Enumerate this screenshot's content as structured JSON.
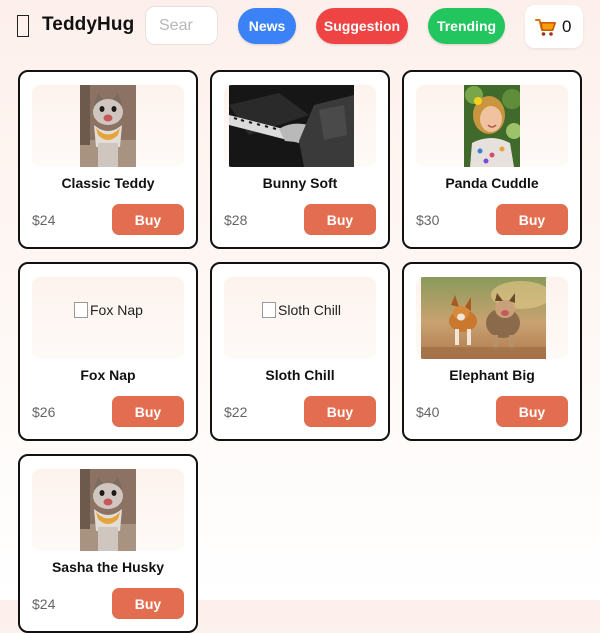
{
  "header": {
    "logo_icon": "bear-icon",
    "brand": "TeddyHug",
    "search_placeholder": "Sear",
    "nav": [
      {
        "label": "News",
        "color": "#3b82f6"
      },
      {
        "label": "Suggestion",
        "color": "#ef4444"
      },
      {
        "label": "Trending",
        "color": "#22c55e"
      }
    ],
    "cart_icon": "shopping-cart-icon",
    "cart_count": "0"
  },
  "buy_color": "#e26d50",
  "products": [
    {
      "name": "Classic Teddy",
      "price": "$24",
      "buy_label": "Buy",
      "image": "cat-photo"
    },
    {
      "name": "Bunny Soft",
      "price": "$28",
      "buy_label": "Buy",
      "image": "piano-photo"
    },
    {
      "name": "Panda Cuddle",
      "price": "$30",
      "buy_label": "Buy",
      "image": "girl-photo"
    },
    {
      "name": "Fox Nap",
      "price": "$26",
      "buy_label": "Buy",
      "image_alt": "Fox Nap"
    },
    {
      "name": "Sloth Chill",
      "price": "$22",
      "buy_label": "Buy",
      "image_alt": "Sloth Chill"
    },
    {
      "name": "Elephant Big",
      "price": "$40",
      "buy_label": "Buy",
      "image": "dogs-photo"
    },
    {
      "name": "Sasha the Husky",
      "price": "$24",
      "buy_label": "Buy",
      "image": "cat-photo"
    }
  ]
}
